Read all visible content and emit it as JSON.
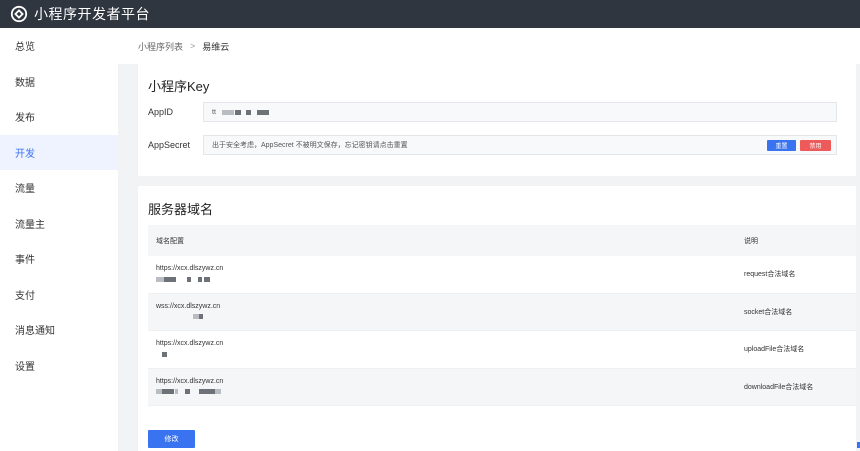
{
  "app": {
    "title": "小程序开发者平台"
  },
  "sidebar": {
    "items": [
      {
        "label": "总览"
      },
      {
        "label": "数据"
      },
      {
        "label": "发布"
      },
      {
        "label": "开发",
        "active": true
      },
      {
        "label": "流量"
      },
      {
        "label": "流量主"
      },
      {
        "label": "事件"
      },
      {
        "label": "支付"
      },
      {
        "label": "消息通知"
      },
      {
        "label": "设置"
      }
    ]
  },
  "breadcrumb": {
    "parent": "小程序列表",
    "separator": ">",
    "current": "易维云"
  },
  "key_section": {
    "title": "小程序Key",
    "appid_label": "AppID",
    "appid_prefix": "tt",
    "appsecret_label": "AppSecret",
    "appsecret_text": "出于安全考虑，AppSecret 不被明文保存，忘记密钥请点击重置",
    "reset_label": "重置",
    "disable_label": "禁用"
  },
  "domain_section": {
    "title": "服务器域名",
    "headers": [
      "域名配置",
      "说明"
    ],
    "rows": [
      {
        "domain": "https://xcx.dlszywz.cn",
        "desc": "request合法域名"
      },
      {
        "domain": "wss://xcx.dlszywz.cn",
        "desc": "socket合法域名"
      },
      {
        "domain": "https://xcx.dlszywz.cn",
        "desc": "uploadFile合法域名"
      },
      {
        "domain": "https://xcx.dlszywz.cn",
        "desc": "downloadFile合法域名"
      }
    ],
    "modify_label": "修改"
  },
  "colors": {
    "accent": "#3a73f0",
    "danger": "#ee5a5a",
    "topbar": "#2f3640"
  }
}
